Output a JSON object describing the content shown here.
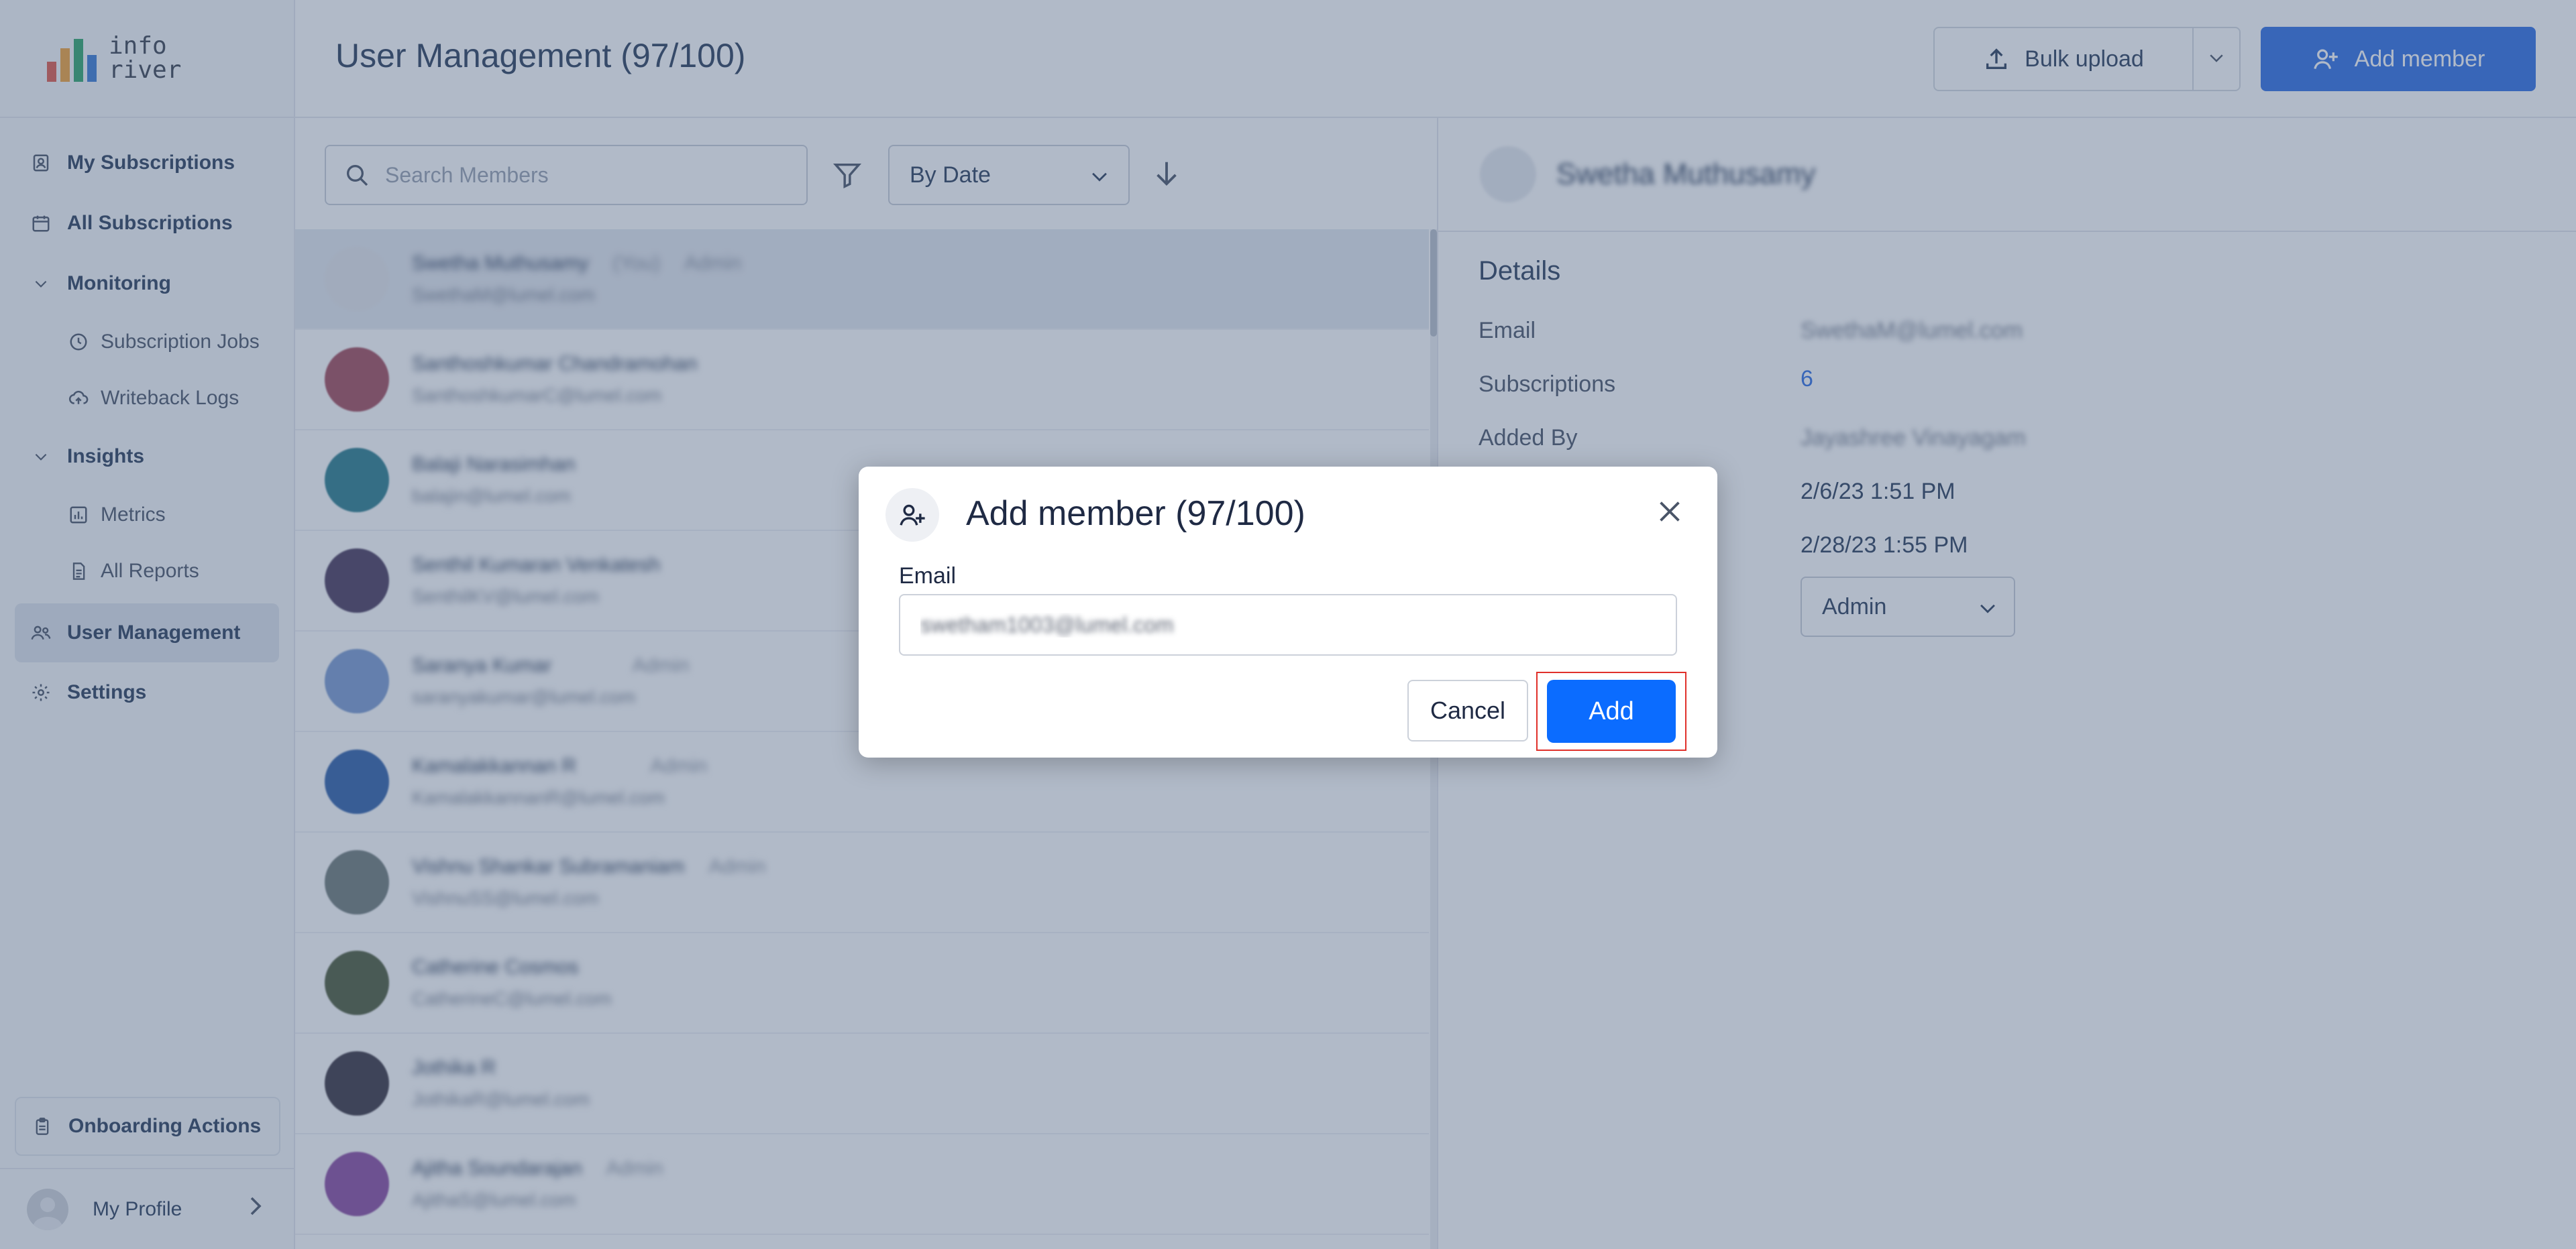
{
  "logo": {
    "line1": "info",
    "line2": "river",
    "bar_colors": [
      "#e05a4a",
      "#f2a33a",
      "#2fa66b",
      "#3a7bd5"
    ]
  },
  "sidebar": {
    "items": [
      {
        "label": "My Subscriptions",
        "icon": "subscription-icon"
      },
      {
        "label": "All Subscriptions",
        "icon": "calendar-icon"
      },
      {
        "label": "Monitoring",
        "icon": "chevron-down-icon"
      },
      {
        "label": "Subscription Jobs",
        "icon": "clock-icon"
      },
      {
        "label": "Writeback Logs",
        "icon": "cloud-upload-icon"
      },
      {
        "label": "Insights",
        "icon": "chevron-down-icon"
      },
      {
        "label": "Metrics",
        "icon": "chart-icon"
      },
      {
        "label": "All Reports",
        "icon": "document-icon"
      },
      {
        "label": "User Management",
        "icon": "users-icon"
      },
      {
        "label": "Settings",
        "icon": "gear-icon"
      }
    ],
    "onboarding": "Onboarding Actions",
    "profile": "My Profile"
  },
  "header": {
    "title": "User Management (97/100)",
    "bulk_upload": "Bulk upload",
    "add_member": "Add member",
    "accent": "#2f6fe4"
  },
  "list": {
    "search_placeholder": "Search Members",
    "sort_value": "By Date",
    "rows": [
      {
        "name": "Swetha Muthusamy",
        "tag1": "(You)",
        "tag2": "Admin",
        "email": "SwethaM@lumel.com"
      },
      {
        "name": "Santhoshkumar Chandramohan",
        "tag1": "",
        "tag2": "",
        "email": "SanthoshkumarC@lumel.com"
      },
      {
        "name": "Balaji Narasimhan",
        "tag1": "",
        "tag2": "",
        "email": "balajin@lumel.com"
      },
      {
        "name": "Senthil Kumaran Venkatesh",
        "tag1": "",
        "tag2": "",
        "email": "SenthilKV@lumel.com"
      },
      {
        "name": "Saranya Kumar",
        "tag1": "",
        "tag2": "Admin",
        "email": "saranyakumar@lumel.com"
      },
      {
        "name": "Kamalakkannan R",
        "tag1": "",
        "tag2": "Admin",
        "email": "KamalakkannanR@lumel.com"
      },
      {
        "name": "Vishnu Shankar Subramaniam",
        "tag1": "",
        "tag2": "Admin",
        "email": "VishnuSS@lumel.com"
      },
      {
        "name": "Catherine Cosmos",
        "tag1": "",
        "tag2": "",
        "email": "CatherineC@lumel.com"
      },
      {
        "name": "Jothika R",
        "tag1": "",
        "tag2": "",
        "email": "JothikaR@lumel.com"
      },
      {
        "name": "Ajitha Soundarajan",
        "tag1": "",
        "tag2": "Admin",
        "email": "AjithaS@lumel.com"
      }
    ]
  },
  "details": {
    "header_name": "Swetha Muthusamy",
    "title": "Details",
    "email_label": "Email",
    "email_value": "SwethaM@lumel.com",
    "subs_label": "Subscriptions",
    "subs_value": "6",
    "added_by_label": "Added By",
    "added_by_value": "Jayashree Vinayagam",
    "date1": "2/6/23 1:51 PM",
    "date2": "2/28/23 1:55 PM",
    "role": "Admin"
  },
  "modal": {
    "title": "Add member (97/100)",
    "email_label": "Email",
    "email_value": "swetham1003@lumel.com",
    "cancel": "Cancel",
    "add": "Add",
    "add_color": "#0b6cff",
    "highlight_color": "#e0302a"
  }
}
